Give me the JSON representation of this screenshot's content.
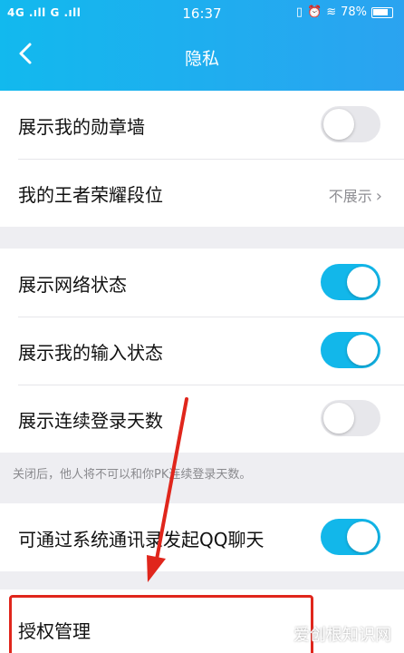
{
  "status_bar": {
    "left": "4G .ıll G .ıll",
    "time": "16:37",
    "right": "▯▯ ⏰ ≈ 78%"
  },
  "nav": {
    "title": "隐私"
  },
  "group1": [
    {
      "label": "展示我的勋章墙",
      "toggle": false
    },
    {
      "label": "我的王者荣耀段位",
      "value": "不展示"
    }
  ],
  "group2": [
    {
      "label": "展示网络状态",
      "toggle": true
    },
    {
      "label": "展示我的输入状态",
      "toggle": true
    },
    {
      "label": "展示连续登录天数",
      "toggle": false
    }
  ],
  "hint": "关闭后，他人将不可以和你PK连续登录天数。",
  "group3": [
    {
      "label": "可通过系统通讯录发起QQ聊天",
      "toggle": true
    }
  ],
  "group4": [
    {
      "label": "授权管理"
    }
  ],
  "watermark": "爱创根知识网",
  "colors": {
    "accent": "#12b7ea",
    "annotation": "#e0261c"
  }
}
